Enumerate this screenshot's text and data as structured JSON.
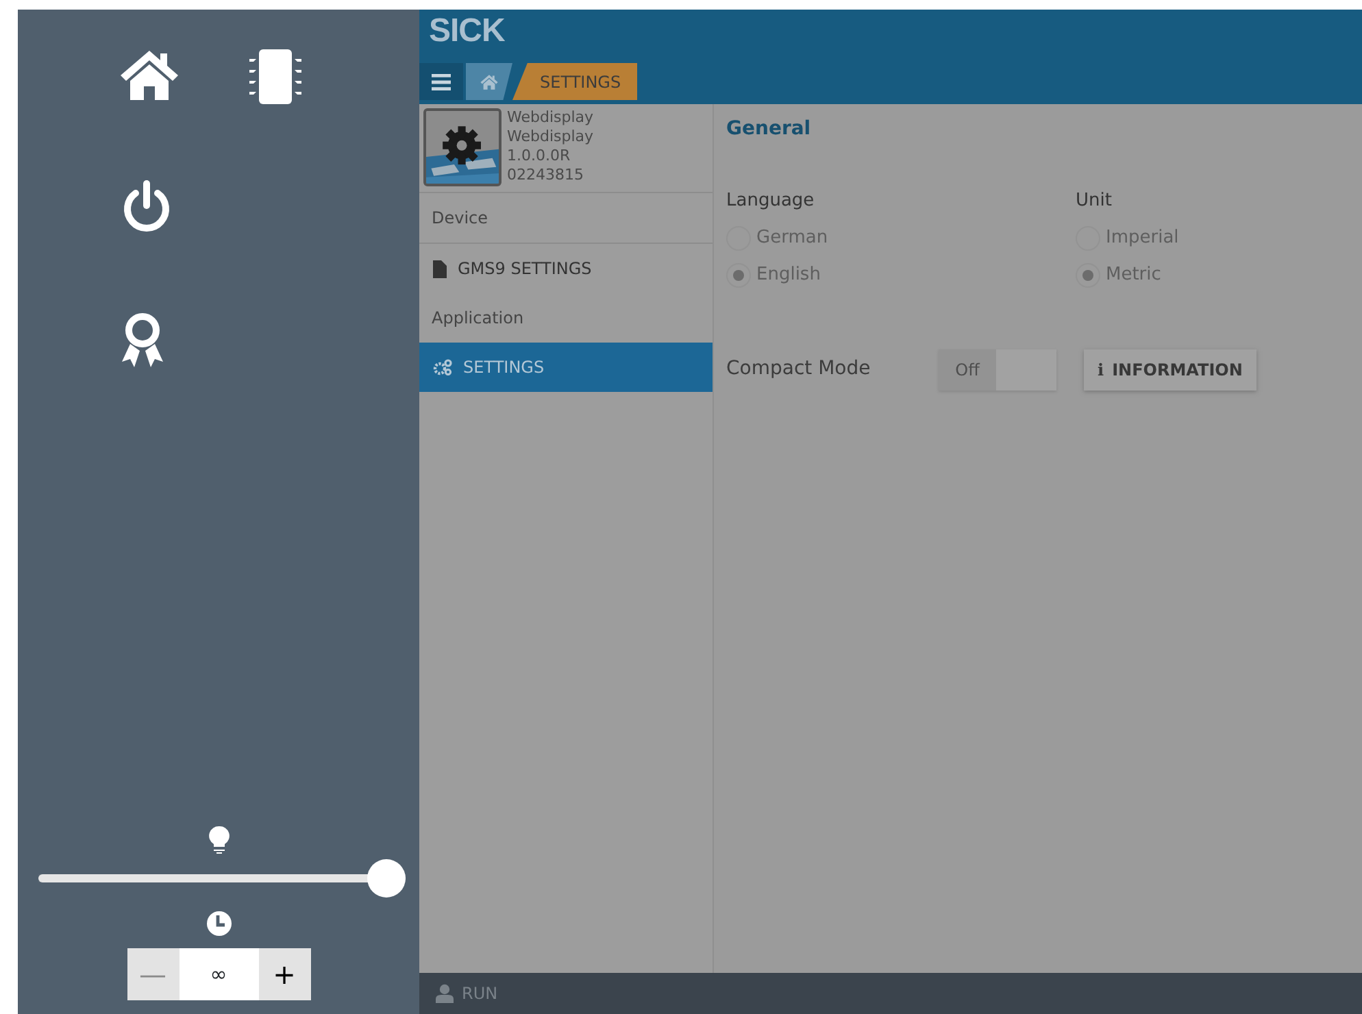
{
  "left_panel": {
    "brightness": {
      "level": 1
    },
    "timeout": {
      "minus": "—",
      "value": "∞",
      "plus": "+"
    }
  },
  "header": {
    "logo": "SICK",
    "breadcrumb": [
      {
        "label": "SETTINGS"
      }
    ]
  },
  "device": {
    "lines": [
      "Webdisplay",
      "Webdisplay",
      "1.0.0.0R",
      "02243815"
    ]
  },
  "nav": [
    {
      "kind": "heading",
      "label": "Device"
    },
    {
      "kind": "item",
      "label": "GMS9 SETTINGS",
      "selected": false
    },
    {
      "kind": "heading",
      "label": "Application"
    },
    {
      "kind": "item",
      "label": "SETTINGS",
      "selected": true
    }
  ],
  "section_title": "General",
  "groups": [
    {
      "label": "Language",
      "options": [
        {
          "label": "German",
          "selected": false
        },
        {
          "label": "English",
          "selected": true
        }
      ]
    },
    {
      "label": "Unit",
      "options": [
        {
          "label": "Imperial",
          "selected": false
        },
        {
          "label": "Metric",
          "selected": true
        }
      ]
    }
  ],
  "compact_mode": {
    "label": "Compact Mode",
    "state": "Off",
    "on": false
  },
  "info_button": {
    "glyph": "i",
    "label": "INFORMATION"
  },
  "status": "RUN"
}
